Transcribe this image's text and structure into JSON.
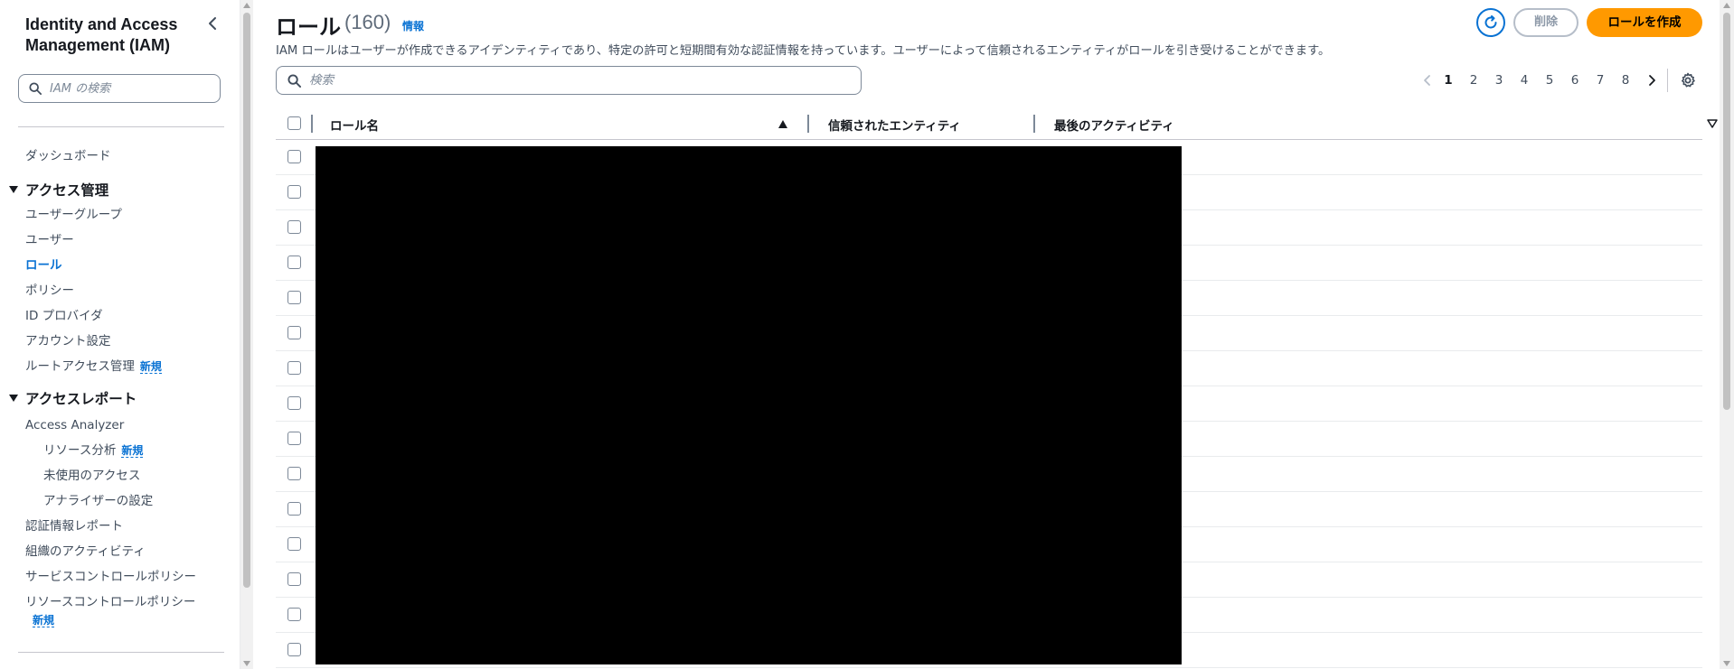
{
  "sidebar": {
    "title": "Identity and Access Management (IAM)",
    "search_placeholder": "IAM の検索",
    "items": [
      {
        "label": "ダッシュボード"
      },
      {
        "label": "アクセス管理"
      },
      {
        "label": "ユーザーグループ"
      },
      {
        "label": "ユーザー"
      },
      {
        "label": "ロール"
      },
      {
        "label": "ポリシー"
      },
      {
        "label": "ID プロバイダ"
      },
      {
        "label": "アカウント設定"
      },
      {
        "label": "ルートアクセス管理",
        "badge": "新規"
      },
      {
        "label": "アクセスレポート"
      },
      {
        "label": "Access Analyzer"
      },
      {
        "label": "リソース分析",
        "badge": "新規"
      },
      {
        "label": "未使用のアクセス"
      },
      {
        "label": "アナライザーの設定"
      },
      {
        "label": "認証情報レポート"
      },
      {
        "label": "組織のアクティビティ"
      },
      {
        "label": "サービスコントロールポリシー"
      },
      {
        "label": "リソースコントロールポリシー",
        "badge": "新規"
      }
    ]
  },
  "header": {
    "title": "ロール",
    "count": "(160)",
    "info": "情報",
    "description": "IAM ロールはユーザーが作成できるアイデンティティであり、特定の許可と短期間有効な認証情報を持っています。ユーザーによって信頼されるエンティティがロールを引き受けることができます。",
    "delete_label": "削除",
    "create_label": "ロールを作成"
  },
  "table": {
    "search_placeholder": "検索",
    "pages": [
      "1",
      "2",
      "3",
      "4",
      "5",
      "6",
      "7",
      "8"
    ],
    "current_page": "1",
    "columns": [
      "ロール名",
      "信頼されたエンティティ",
      "最後のアクティビティ"
    ],
    "sort": {
      "column": "ロール名",
      "direction": "ascending"
    },
    "visible_rows": 15,
    "rows_redacted": true
  },
  "colors": {
    "accent": "#0972d3",
    "primary_button": "#ff9900",
    "redaction": "#000000"
  },
  "icons": [
    "chevron-left-icon",
    "search-icon",
    "refresh-icon",
    "caret-down-icon",
    "sort-ascending-icon",
    "sort-descending-icon",
    "gear-icon",
    "chevron-right-icon"
  ]
}
